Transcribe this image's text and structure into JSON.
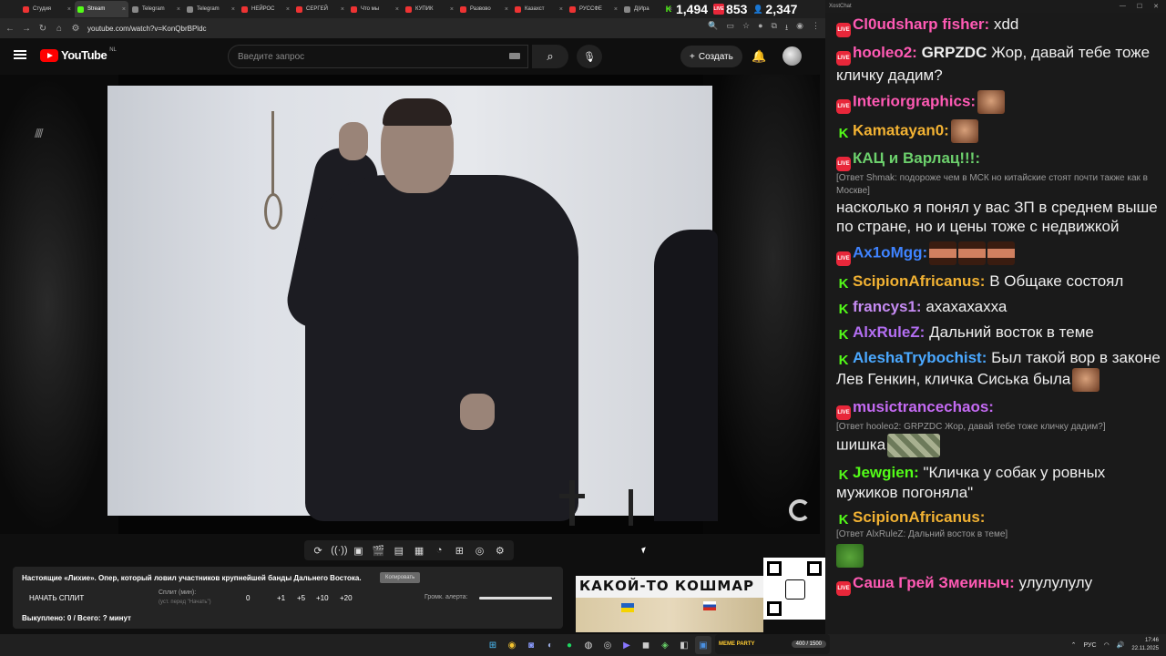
{
  "browser": {
    "tabs": [
      {
        "label": "Студия",
        "color": "#e33"
      },
      {
        "label": "Stream",
        "color": "#53fc18",
        "active": true
      },
      {
        "label": "Telegram",
        "color": "#888"
      },
      {
        "label": "Telegram",
        "color": "#888"
      },
      {
        "label": "НЕЙРОС",
        "color": "#e33"
      },
      {
        "label": "СЕРГЕЙ",
        "color": "#e33"
      },
      {
        "label": "Что мы",
        "color": "#e33"
      },
      {
        "label": "КУПИК",
        "color": "#e33"
      },
      {
        "label": "Развово",
        "color": "#e33"
      },
      {
        "label": "Казахст",
        "color": "#e33"
      },
      {
        "label": "РУССФЕ",
        "color": "#e33"
      },
      {
        "label": "Д|Ира",
        "color": "#888"
      }
    ],
    "url": "youtube.com/watch?v=KonQbrBPldc",
    "stats": {
      "kick_viewers": "1,494",
      "yt_viewers": "853",
      "total_viewers": "2,347"
    }
  },
  "youtube": {
    "logo_text": "YouTube",
    "country_code": "NL",
    "search_placeholder": "Введите запрос",
    "create_label": "Создать"
  },
  "toolbar_icons": [
    "loop-icon",
    "audio-icon",
    "vr-icon",
    "clapper-icon",
    "pip-icon",
    "subtitle-icon",
    "speed-icon",
    "add-icon",
    "screenshot-icon",
    "settings-icon"
  ],
  "split_panel": {
    "video_title": "Настоящие «Лихие». Опер, который ловил участников крупнейшей банды Дальнего Востока.",
    "copy_label": "Копировать",
    "start_split": "НАЧАТЬ СПЛИТ",
    "split_min_label": "Сплит (мин):",
    "split_hint": "(уст. перед \"Начать\")",
    "split_value": "0",
    "increments": [
      "+1",
      "+5",
      "+10",
      "+20"
    ],
    "alert_volume_label": "Громк. алерта:",
    "alert_volume": 1.0,
    "bought": "Выкуплено: 0 / Всего: ? минут"
  },
  "banner": {
    "title": "КАКОЙ-ТО КОШМАР"
  },
  "chat": {
    "window_title": "XostChat",
    "messages": [
      {
        "platform": "live",
        "user": "Cl0udsharp fisher:",
        "color": "#ff5ab4",
        "text": "xdd"
      },
      {
        "platform": "live",
        "user": "hooleo2:",
        "color": "#ff5ab4",
        "text_bold": "GRPZDC",
        "text": "Жор, давай тебе тоже кличку дадим?"
      },
      {
        "platform": "live",
        "user": "Interiorgraphics:",
        "color": "#ff5ab4",
        "emote": "face"
      },
      {
        "platform": "kick",
        "user": "Kamatayan0:",
        "color": "#f2b233",
        "emote": "face"
      },
      {
        "platform": "live",
        "user": "КАЦ и Варлац!!!:",
        "color": "#6cd06c",
        "reply": "[Ответ Shmak: подороже чем в МСК но китайские стоят почти также как в Москве]",
        "text": "насколько я понял у вас ЗП в среднем выше по стране, но и цены тоже с недвижкой"
      },
      {
        "platform": "live",
        "user": "Ax1oMgg:",
        "color": "#3f83ff",
        "emote": "eyes3"
      },
      {
        "platform": "kick",
        "user": "ScipionAfricanus:",
        "color": "#f2b233",
        "text": "В Общаке состоял"
      },
      {
        "platform": "kick",
        "user": "francys1:",
        "color": "#c58bf2",
        "text": "ахахахахха"
      },
      {
        "platform": "kick",
        "user": "AlxRuleZ:",
        "color": "#b36ef2",
        "text": "Дальний восток в теме"
      },
      {
        "platform": "kick",
        "user": "AleshaTrybochist:",
        "color": "#4aa8ff",
        "text": "Был такой вор в законе Лев Генкин, кличка Сиська была",
        "emote": "face"
      },
      {
        "platform": "live",
        "user": "musictrancechaos:",
        "color": "#c46af2",
        "reply": "[Ответ hooleo2: GRPZDC Жор, давай тебе тоже кличку дадим?]",
        "text": "шишка",
        "emote": "camo"
      },
      {
        "platform": "kick",
        "user": "Jewgien:",
        "color": "#53fc18",
        "text": "\"Кличка у собак у ровных мужиков погоняла\""
      },
      {
        "platform": "kick",
        "user": "ScipionAfricanus:",
        "color": "#f2b233",
        "reply": "[Ответ AlxRuleZ: Дальний восток в теме]",
        "emote": "frog"
      },
      {
        "platform": "live",
        "user": "Саша Грей Змеиныч:",
        "color": "#ff5ab4",
        "text": "улулулулу"
      }
    ]
  },
  "taskbar": {
    "game_label": "MEME PARTY",
    "game_counter": "400 / 1500",
    "lang": "РУС",
    "time": "17:46",
    "date": "22.11.2025"
  }
}
